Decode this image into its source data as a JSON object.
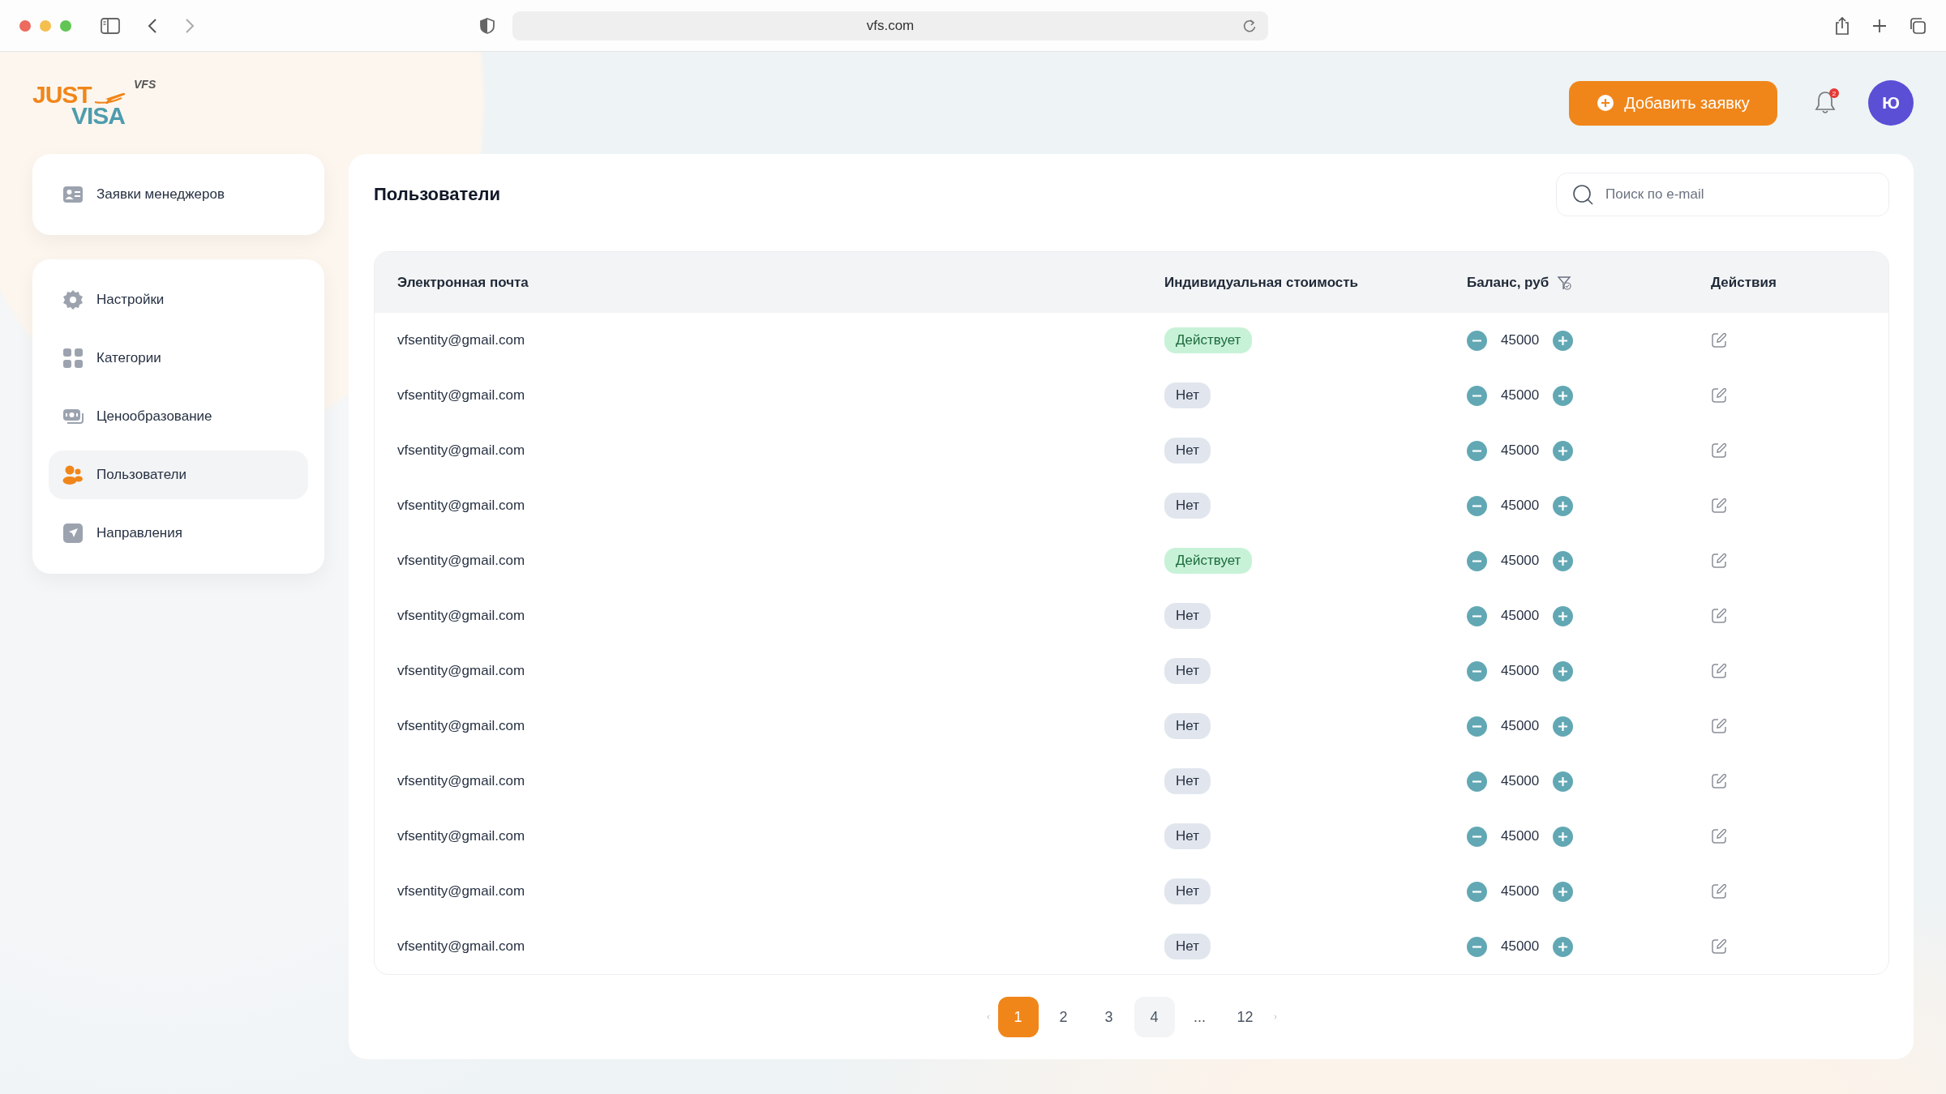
{
  "browser": {
    "url": "vfs.com"
  },
  "logo": {
    "line1": "JUST",
    "line2": "VISA",
    "tag": "VFS"
  },
  "header": {
    "add_button": "Добавить заявку",
    "notifications": "2",
    "avatar": "Ю"
  },
  "sidebar": {
    "groups": [
      [
        {
          "label": "Заявки менеджеров",
          "kind": "card",
          "selected": false
        }
      ],
      [
        {
          "label": "Настройки",
          "kind": "gear",
          "selected": false
        },
        {
          "label": "Категории",
          "kind": "grid",
          "selected": false
        },
        {
          "label": "Ценообразование",
          "kind": "money",
          "selected": false
        },
        {
          "label": "Пользователи",
          "kind": "users",
          "selected": true
        },
        {
          "label": "Направления",
          "kind": "send",
          "selected": false
        }
      ]
    ]
  },
  "page": {
    "title": "Пользователи",
    "search": {
      "placeholder": "Поиск по e-mail"
    }
  },
  "table": {
    "columns": [
      "Электронная почта",
      "Индивидуальная стоимость",
      "Баланс, руб",
      "Действия"
    ],
    "rows": [
      {
        "email": "vfsentity@gmail.com",
        "individual": "Действует",
        "active": true,
        "balance": "45000"
      },
      {
        "email": "vfsentity@gmail.com",
        "individual": "Нет",
        "active": false,
        "balance": "45000"
      },
      {
        "email": "vfsentity@gmail.com",
        "individual": "Нет",
        "active": false,
        "balance": "45000"
      },
      {
        "email": "vfsentity@gmail.com",
        "individual": "Нет",
        "active": false,
        "balance": "45000"
      },
      {
        "email": "vfsentity@gmail.com",
        "individual": "Действует",
        "active": true,
        "balance": "45000"
      },
      {
        "email": "vfsentity@gmail.com",
        "individual": "Нет",
        "active": false,
        "balance": "45000"
      },
      {
        "email": "vfsentity@gmail.com",
        "individual": "Нет",
        "active": false,
        "balance": "45000"
      },
      {
        "email": "vfsentity@gmail.com",
        "individual": "Нет",
        "active": false,
        "balance": "45000"
      },
      {
        "email": "vfsentity@gmail.com",
        "individual": "Нет",
        "active": false,
        "balance": "45000"
      },
      {
        "email": "vfsentity@gmail.com",
        "individual": "Нет",
        "active": false,
        "balance": "45000"
      },
      {
        "email": "vfsentity@gmail.com",
        "individual": "Нет",
        "active": false,
        "balance": "45000"
      },
      {
        "email": "vfsentity@gmail.com",
        "individual": "Нет",
        "active": false,
        "balance": "45000"
      }
    ]
  },
  "pagination": {
    "pages": [
      {
        "label": "1",
        "selected": true,
        "hovered": false
      },
      {
        "label": "2",
        "selected": false,
        "hovered": false
      },
      {
        "label": "3",
        "selected": false,
        "hovered": false
      },
      {
        "label": "4",
        "selected": false,
        "hovered": true
      },
      {
        "label": "...",
        "selected": false,
        "hovered": false
      },
      {
        "label": "12",
        "selected": false,
        "hovered": false
      }
    ]
  }
}
